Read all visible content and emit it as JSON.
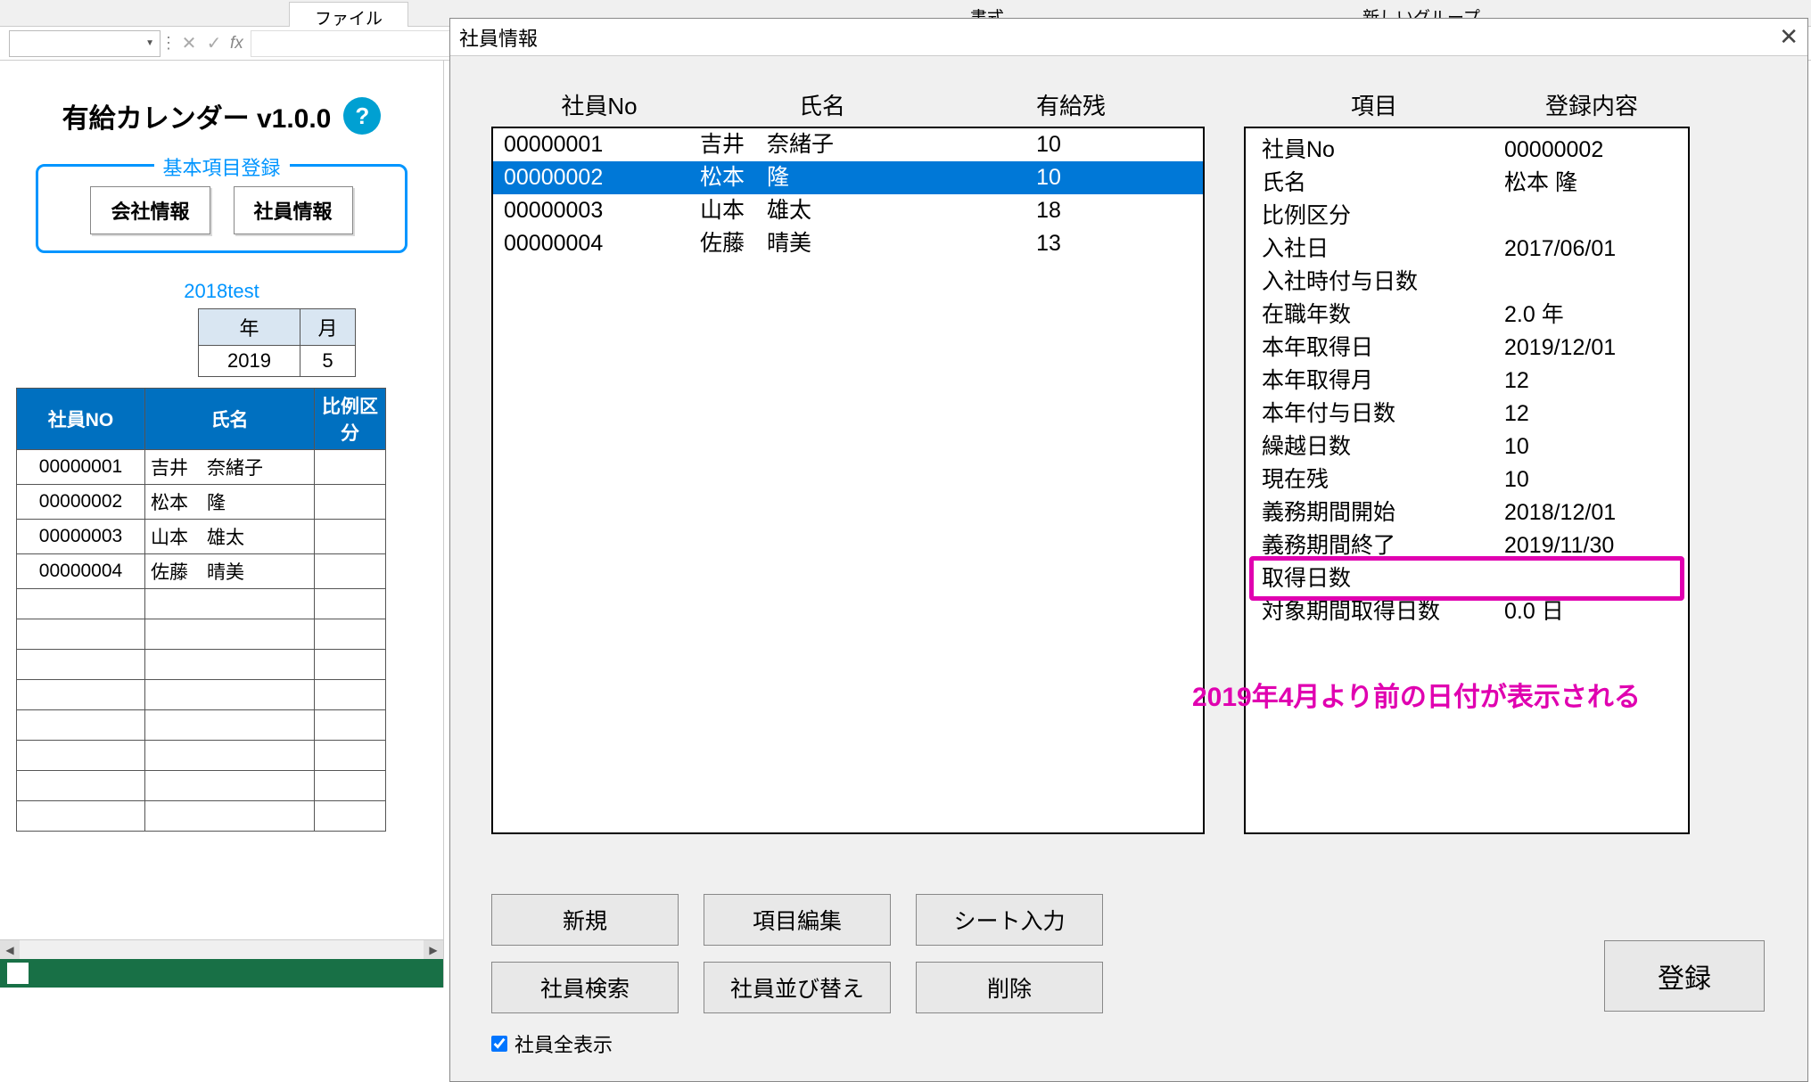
{
  "ribbon": {
    "file": "ファイル",
    "format": "書式",
    "newgroup": "新しいグループ"
  },
  "sheet": {
    "title": "有給カレンダー v1.0.0",
    "help": "?",
    "fieldset_legend": "基本項目登録",
    "btn_company": "会社情報",
    "btn_employee": "社員情報",
    "year_label": "2018test",
    "mini_headers": {
      "year": "年",
      "month": "月"
    },
    "mini_values": {
      "year": "2019",
      "month": "5"
    },
    "table_headers": {
      "no": "社員NO",
      "name": "氏名",
      "div": "比例区分"
    },
    "rows": [
      {
        "no": "00000001",
        "name": "吉井　奈緒子",
        "div": ""
      },
      {
        "no": "00000002",
        "name": "松本　隆",
        "div": ""
      },
      {
        "no": "00000003",
        "name": "山本　雄太",
        "div": ""
      },
      {
        "no": "00000004",
        "name": "佐藤　晴美",
        "div": ""
      }
    ]
  },
  "dialog": {
    "title": "社員情報",
    "list_headers": {
      "no": "社員No",
      "name": "氏名",
      "remain": "有給残"
    },
    "list": [
      {
        "no": "00000001",
        "name": "吉井　奈緒子",
        "remain": "10",
        "selected": false
      },
      {
        "no": "00000002",
        "name": "松本　隆",
        "remain": "10",
        "selected": true
      },
      {
        "no": "00000003",
        "name": "山本　雄太",
        "remain": "18",
        "selected": false
      },
      {
        "no": "00000004",
        "name": "佐藤　晴美",
        "remain": "13",
        "selected": false
      }
    ],
    "detail_headers": {
      "item": "項目",
      "content": "登録内容"
    },
    "details": [
      {
        "k": "社員No",
        "v": "00000002"
      },
      {
        "k": "氏名",
        "v": "松本 隆"
      },
      {
        "k": "比例区分",
        "v": ""
      },
      {
        "k": "入社日",
        "v": "2017/06/01"
      },
      {
        "k": "入社時付与日数",
        "v": ""
      },
      {
        "k": "在職年数",
        "v": "2.0 年"
      },
      {
        "k": "本年取得日",
        "v": "2019/12/01"
      },
      {
        "k": "本年取得月",
        "v": "12"
      },
      {
        "k": "本年付与日数",
        "v": "12"
      },
      {
        "k": "繰越日数",
        "v": "10"
      },
      {
        "k": "",
        "v": ""
      },
      {
        "k": "現在残",
        "v": "10"
      },
      {
        "k": "",
        "v": ""
      },
      {
        "k": "義務期間開始",
        "v": "2018/12/01"
      },
      {
        "k": "義務期間終了",
        "v": "2019/11/30"
      },
      {
        "k": "取得日数",
        "v": ""
      },
      {
        "k": "対象期間取得日数",
        "v": "0.0 日"
      }
    ],
    "annotation": "2019年4月より前の日付が表示される",
    "buttons": {
      "new": "新規",
      "edit": "項目編集",
      "sheet": "シート入力",
      "search": "社員検索",
      "sort": "社員並び替え",
      "delete": "削除",
      "register": "登録",
      "showall": "社員全表示"
    }
  }
}
